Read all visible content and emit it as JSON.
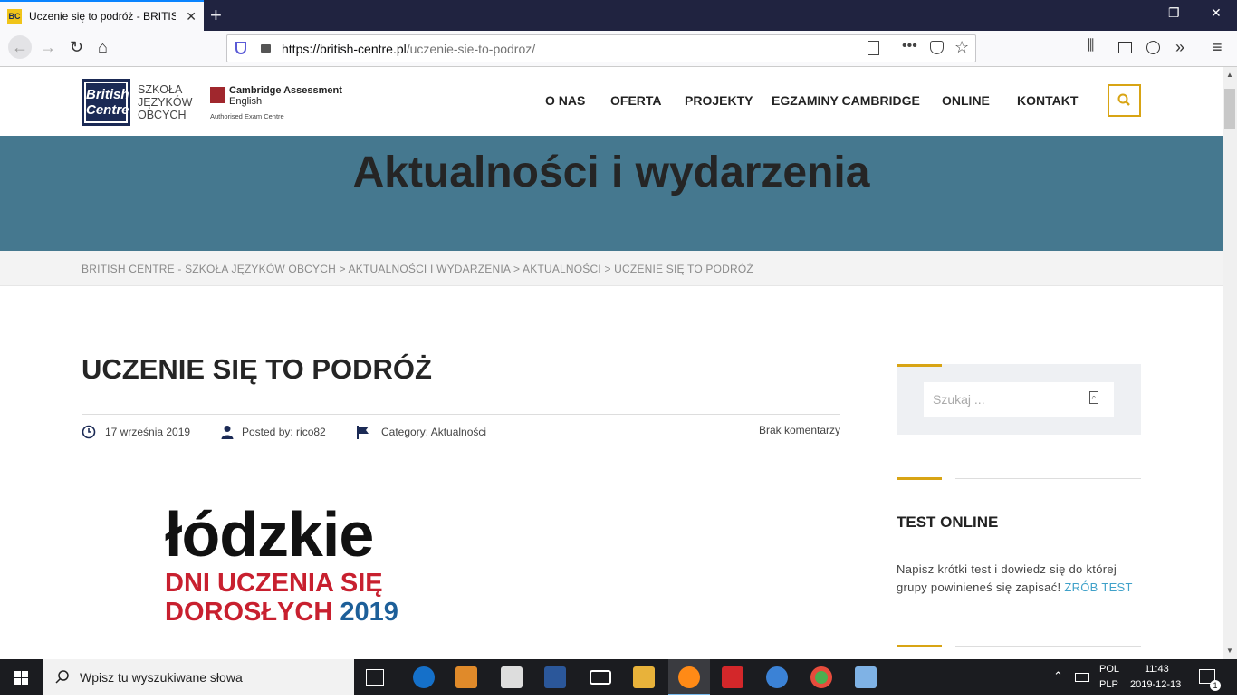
{
  "browser": {
    "tab_title": "Uczenie się to podróż - BRITISH",
    "tab_favicon_text": "BC",
    "url_domain": "https://british-centre.pl",
    "url_path": "/uczenie-sie-to-podroz/"
  },
  "site": {
    "logo_text_1": "British",
    "logo_text_2": "Centre",
    "school_line_1": "SZKOŁA",
    "school_line_2": "JĘZYKÓW",
    "school_line_3": "OBCYCH",
    "cambridge_line_1": "Cambridge Assessment",
    "cambridge_line_2": "English",
    "cambridge_sub": "Authorised Exam Centre",
    "menu": [
      "O NAS",
      "OFERTA",
      "PROJEKTY",
      "EGZAMINY CAMBRIDGE",
      "ONLINE",
      "KONTAKT"
    ],
    "hero_title": "Aktualności i wydarzenia",
    "breadcrumb": "BRITISH CENTRE - SZKOŁA JĘZYKÓW OBCYCH > AKTUALNOŚCI I WYDARZENIA > AKTUALNOŚCI > UCZENIE SIĘ TO PODRÓŻ"
  },
  "post": {
    "title": "UCZENIE SIĘ TO PODRÓŻ",
    "date": "17 września 2019",
    "posted_by": "Posted by: rico82",
    "category": "Category: Aktualności",
    "comments": "Brak komentarzy",
    "image_word": "łódzkie",
    "image_line_1": "DNI UCZENIA SIĘ",
    "image_line_2": "DOROSŁYCH",
    "image_year": "2019"
  },
  "sidebar": {
    "search_placeholder": "Szukaj ...",
    "test_title": "TEST ONLINE",
    "test_text": "Napisz krótki test i dowiedz się do której grupy powinieneś się zapisać!",
    "test_link": "ZRÓB TEST"
  },
  "taskbar": {
    "search_text": "Wpisz tu wyszukiwane słowa",
    "lang_1": "POL",
    "lang_2": "PLP",
    "time": "11:43",
    "date": "2019-12-13",
    "notifications": "1"
  },
  "colors": {
    "hero": "#45788f",
    "accent": "#d8a414",
    "link": "#3fa1c9"
  }
}
